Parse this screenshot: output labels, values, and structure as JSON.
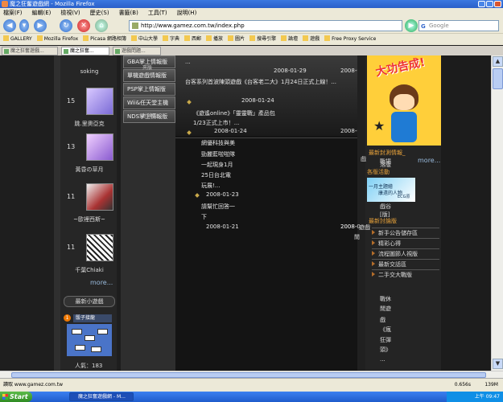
{
  "window": {
    "title": "魔之狂奮遊戲網 - Mozilla Firefox"
  },
  "menu": [
    "檔案(F)",
    "編輯(E)",
    "檢視(V)",
    "歷史(S)",
    "書籤(B)",
    "工具(T)",
    "說明(H)"
  ],
  "nav": {
    "url": "http://www.gamez.com.tw/index.php",
    "search_placeholder": "Google",
    "search_engine_letter": "G"
  },
  "bookmarks": [
    "GALLERY",
    "Mozilla Firefox",
    "Picasa 網路相簿",
    "中山大學",
    "字典",
    "西郵",
    "播放",
    "圖片",
    "搜尋引擎",
    "論壇",
    "遊戲",
    "Free Proxy Service"
  ],
  "tabs": [
    "魔之狂奮遊戲...",
    "魔之狂奮...",
    "遊戲問題..."
  ],
  "sidebar_left": {
    "top_name": "soking",
    "cards": [
      {
        "num": "15",
        "name": "跳.里奧亞克"
      },
      {
        "num": "13",
        "name": "黃昏の草月"
      },
      {
        "num": "11",
        "name": "~歐裡西斯~"
      },
      {
        "num": "11",
        "name": "千葉Chiaki"
      }
    ],
    "more": "more...",
    "minigames_title": "最新小遊戲",
    "game": {
      "rank": "1",
      "title": "骰子接龍",
      "popularity": "人氣：183"
    }
  },
  "categories": [
    "GBA掌上情報版",
    "單機遊戲情報版",
    "PSP掌上情報版",
    "Wii&任天堂主機",
    "NDS掌上情報版"
  ],
  "category_overlay": "夾版",
  "category_overlay2": "討論區",
  "news": [
    {
      "text": "...",
      "date": "2008-01-29",
      "date2": "2008-0"
    },
    {
      "text": "台客系列首波陳頭遊戲《台客老二大》1月24日正式上線！...",
      "date": "2008-01-24"
    },
    {
      "text": "《遊遙online》「靈靈戰」產品包1/23正式上市！...",
      "date": "2008-01-24",
      "date2": "2008-0"
    },
    {
      "text_lines": [
        "網優科技與美",
        "勁麗藍啦啦隊",
        "一起現身1月",
        "25日台北電",
        "玩展!..."
      ],
      "date": "2008-01-23"
    },
    {
      "text_lines": [
        "請幫忙回答一",
        "下"
      ],
      "date": "2008-01-21",
      "date2": "2008-0"
    }
  ],
  "right": {
    "banner_text": "大功告成!",
    "section1": "最新封測情報_",
    "item1": "戰場",
    "item1b": "落版",
    "more1": "more...",
    "section2": "各版活動",
    "ad_text": "一月主題繪",
    "ad_text2": "康遠的人物",
    "ad_small": "ECG原",
    "item2": "戲谷",
    "item2b": "[版]",
    "section3": "最新討論版",
    "menu_items": [
      "新手公告儲存區",
      "精彩心得",
      "流程圖節人視版",
      "最新交話區",
      "二手交大戰版"
    ],
    "vertical_text": [
      "戰休",
      "閒遊",
      "戲",
      "《瘋",
      "狂彈",
      "頭》",
      "..."
    ],
    "mid_label": "2008-0",
    "overlay_text": "戲",
    "overlay_text2": "遊戲",
    "overlay_text3": "閒"
  },
  "status": {
    "text": "讀取 www.gamez.com.tw",
    "mem": "0.656s",
    "mem2": "139M"
  },
  "taskbar": {
    "start": "Start",
    "window": "魔之狂奮遊戲網 - M...",
    "time": "上午 09:47"
  }
}
